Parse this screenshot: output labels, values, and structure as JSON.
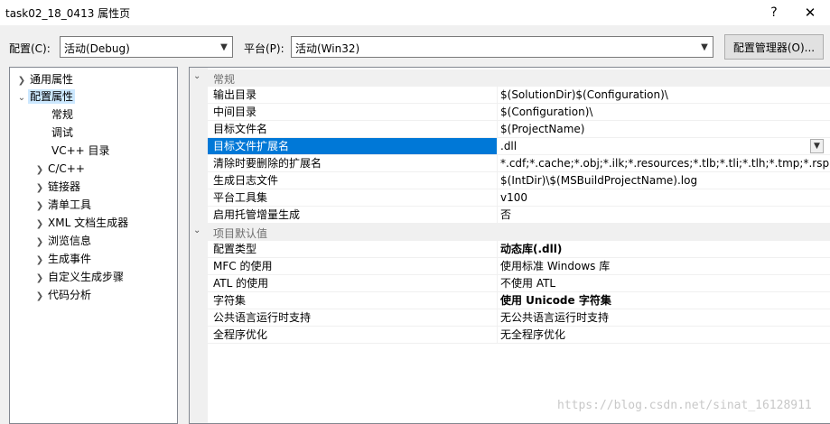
{
  "window": {
    "title": "task02_18_0413 属性页",
    "help": "?",
    "close": "✕"
  },
  "config": {
    "label": "配置(C):",
    "value": "活动(Debug)",
    "platform_label": "平台(P):",
    "platform_value": "活动(Win32)",
    "manager_button": "配置管理器(O)..."
  },
  "tree": {
    "common": "通用属性",
    "config_props": "配置属性",
    "items": [
      "常规",
      "调试",
      "VC++ 目录"
    ],
    "expandable": [
      "C/C++",
      "链接器",
      "清单工具",
      "XML 文档生成器",
      "浏览信息",
      "生成事件",
      "自定义生成步骤",
      "代码分析"
    ]
  },
  "grid": {
    "cat1": "常规",
    "rows1": [
      {
        "name": "输出目录",
        "value": "$(SolutionDir)$(Configuration)\\"
      },
      {
        "name": "中间目录",
        "value": "$(Configuration)\\"
      },
      {
        "name": "目标文件名",
        "value": "$(ProjectName)"
      },
      {
        "name": "目标文件扩展名",
        "value": ".dll"
      },
      {
        "name": "清除时要删除的扩展名",
        "value": "*.cdf;*.cache;*.obj;*.ilk;*.resources;*.tlb;*.tli;*.tlh;*.tmp;*.rsp;*.pgc"
      },
      {
        "name": "生成日志文件",
        "value": "$(IntDir)\\$(MSBuildProjectName).log"
      },
      {
        "name": "平台工具集",
        "value": "v100"
      },
      {
        "name": "启用托管增量生成",
        "value": "否"
      }
    ],
    "cat2": "项目默认值",
    "rows2": [
      {
        "name": "配置类型",
        "value": "动态库(.dll)"
      },
      {
        "name": "MFC 的使用",
        "value": "使用标准 Windows 库"
      },
      {
        "name": "ATL 的使用",
        "value": "不使用 ATL"
      },
      {
        "name": "字符集",
        "value": "使用 Unicode 字符集"
      },
      {
        "name": "公共语言运行时支持",
        "value": "无公共语言运行时支持"
      },
      {
        "name": "全程序优化",
        "value": "无全程序优化"
      }
    ]
  },
  "watermark": "https://blog.csdn.net/sinat_16128911"
}
